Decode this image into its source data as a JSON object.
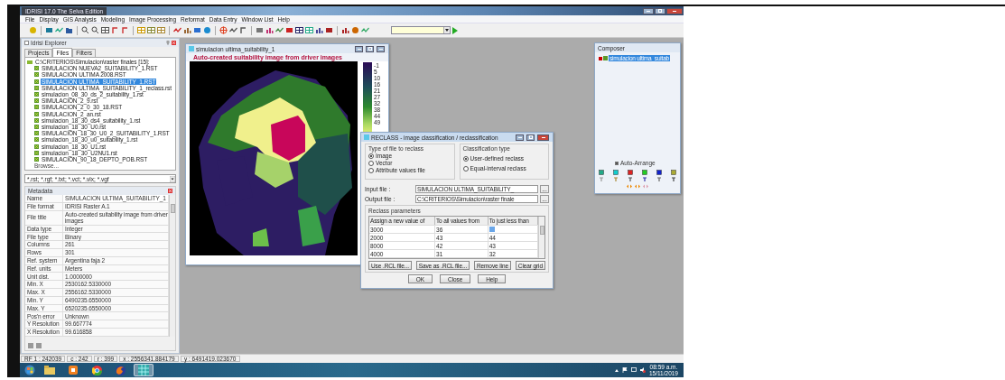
{
  "window": {
    "title": "IDRISI 17.0   The Selva Edition"
  },
  "menu": [
    "File",
    "Display",
    "GIS Analysis",
    "Modeling",
    "Image Processing",
    "Reformat",
    "Data Entry",
    "Window List",
    "Help"
  ],
  "explorer": {
    "title": "Idrisi Explorer",
    "tabs": [
      {
        "label": "Projects",
        "selected": false
      },
      {
        "label": "Files",
        "selected": true
      },
      {
        "label": "Filters",
        "selected": false
      }
    ],
    "tree": {
      "label": "C:\\CRITERIOS\\Simulacion\\raster finales [15]:",
      "expanded": true,
      "children": [
        {
          "label": "SIMULACION NUEVA2_SUITABILITY_1.RST",
          "selected": false
        },
        {
          "label": "SIMULACION ULTIMA 2008.RST",
          "selected": false
        },
        {
          "label": "SIMULACION ULTIMA_SUITABILITY_1.RST",
          "selected": true
        },
        {
          "label": "SIMULACION ULTIMA_SUITABILITY_1_reclass.rst",
          "selected": false
        },
        {
          "label": "simulacion_08_30_ds_2_suitability_1.rst",
          "selected": false
        },
        {
          "label": "SIMULACION_2_9.rst",
          "selected": false
        },
        {
          "label": "SIMULACION_2_0_30_18.RST",
          "selected": false
        },
        {
          "label": "SIMULACION_2_an.rst",
          "selected": false
        },
        {
          "label": "simulacion_18_30_ds4_suitability_1.rst",
          "selected": false
        },
        {
          "label": "simulacion_18_30_U0.rst",
          "selected": false
        },
        {
          "label": "SIMULACION_18_30_U0_2_SUITABILITY_1.RST",
          "selected": false
        },
        {
          "label": "simulacion_18_30_u0_suitability_1.rst",
          "selected": false
        },
        {
          "label": "simulacion_18_30_U1.rst",
          "selected": false
        },
        {
          "label": "simulacion_18_30_U2NU1.rst",
          "selected": false
        },
        {
          "label": "SIMULACION_90_18_DEPTO_POB.RST",
          "selected": false
        }
      ]
    },
    "browse": "Browse...",
    "filter": "*.rst; *.rgf; *.txt; *.vct; *.vlx; *.vgf",
    "metadata": {
      "title": "Metadata",
      "rows": [
        {
          "label": "Name",
          "value": "SIMULACION ULTIMA_SUITABILITY_1"
        },
        {
          "label": "File format",
          "value": "IDRISI Raster A.1"
        },
        {
          "label": "File title",
          "value": "Auto-created suitability image from driver images"
        },
        {
          "label": "Data type",
          "value": "Integer"
        },
        {
          "label": "File type",
          "value": "Binary"
        },
        {
          "label": "Columns",
          "value": "261"
        },
        {
          "label": "Rows",
          "value": "301"
        },
        {
          "label": "Ref. system",
          "value": "Argentina faja 2"
        },
        {
          "label": "Ref. units",
          "value": "Meters"
        },
        {
          "label": "Unit dist.",
          "value": "1.0000000"
        },
        {
          "label": "Min. X",
          "value": "2530162.5330000"
        },
        {
          "label": "Max. X",
          "value": "2556162.5330000"
        },
        {
          "label": "Min. Y",
          "value": "6490235.6550000"
        },
        {
          "label": "Max. Y",
          "value": "6520235.6550000"
        },
        {
          "label": "Pos'n error",
          "value": "Unknown"
        },
        {
          "label": "Y Resolution",
          "value": "99.667774"
        },
        {
          "label": "X Resolution",
          "value": "99.616858"
        }
      ]
    }
  },
  "map_window": {
    "title": "simulacion ultima_suitability_1",
    "heading": "Auto-created suitability image from driver images",
    "legend": [
      "-1",
      "5",
      "10",
      "16",
      "21",
      "27",
      "32",
      "38",
      "44",
      "49"
    ]
  },
  "reclass_dialog": {
    "title": "RECLASS - image classification / reclassification",
    "file_type": {
      "label": "Type of file to reclass",
      "options": [
        {
          "label": "Image",
          "selected": true
        },
        {
          "label": "Vector",
          "selected": false
        },
        {
          "label": "Attribute values file",
          "selected": false
        }
      ]
    },
    "classification": {
      "label": "Classification type",
      "options": [
        {
          "label": "User-defined reclass",
          "selected": true
        },
        {
          "label": "Equal-interval reclass",
          "selected": false
        }
      ]
    },
    "input_file": {
      "label": "Input file :",
      "value": "SIMULACION ULTIMA_SUITABILITY_"
    },
    "output_file": {
      "label": "Output file :",
      "value": "C:\\CRITERIOS\\Simulacion\\raster finale"
    },
    "browse_button": "...",
    "parameters": {
      "label": "Reclass parameters",
      "columns": [
        "Assign a new value of",
        "To all values from",
        "To just less than"
      ],
      "rows": [
        {
          "cells": [
            "3000",
            "36"
          ],
          "selected_cell": true
        },
        {
          "cells": [
            "2000",
            "43",
            "44"
          ],
          "selected_cell": false
        },
        {
          "cells": [
            "8000",
            "42",
            "43"
          ],
          "selected_cell": false
        },
        {
          "cells": [
            "4000",
            "31",
            "32"
          ],
          "selected_cell": false
        }
      ]
    },
    "tool_buttons": [
      "Use .RCL file...",
      "Save as .RCL file...",
      "Remove line",
      "Clear grid"
    ],
    "buttons": [
      "OK",
      "Close",
      "Help"
    ]
  },
  "composer": {
    "title": "Composer",
    "layers": [
      {
        "label": "simulacion ultima_suitab",
        "checked": true,
        "selected": true
      }
    ],
    "auto_arrange": {
      "label": "Auto-Arrange",
      "checked": true
    }
  },
  "status_bar": [
    "RF 1 : 242039",
    "c : 242",
    "r : 399",
    "x : 2556341.884179",
    "y : 6491419.023670"
  ],
  "taskbar": {
    "apps": [
      {
        "kind": "orb",
        "active": false
      },
      {
        "kind": "folder",
        "active": false
      },
      {
        "kind": "player",
        "active": false
      },
      {
        "kind": "wheel",
        "active": false
      },
      {
        "kind": "flame",
        "active": false
      },
      {
        "kind": "grid",
        "active": true
      }
    ],
    "tray": {
      "time": "08:59 a.m.",
      "date": "15/11/2019"
    }
  }
}
